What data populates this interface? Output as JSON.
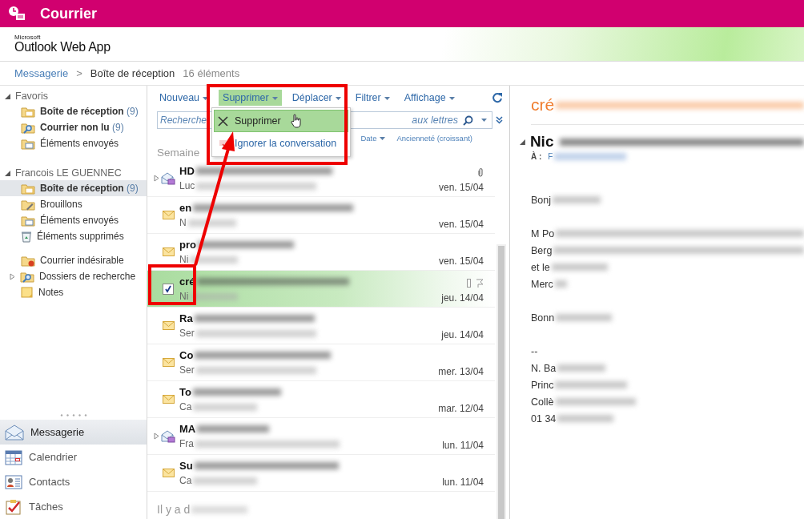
{
  "header": {
    "title": "Courrier"
  },
  "logo": {
    "maker": "Microsoft",
    "product": "Outlook Web App"
  },
  "breadcrumb": {
    "root": "Messagerie",
    "separator": ">",
    "current": "Boîte de réception",
    "count": "16 éléments"
  },
  "sidebar": {
    "groups": [
      {
        "title": "Favoris",
        "expanded": true,
        "sections": [
          {
            "items": [
              {
                "kind": "inbox",
                "label": "Boîte de réception",
                "count": "(9)",
                "unread": true,
                "selected": false,
                "expandable": false
              },
              {
                "kind": "search",
                "label": "Courrier non lu",
                "count": "(9)",
                "unread": true,
                "selected": false,
                "expandable": false
              },
              {
                "kind": "sent",
                "label": "Éléments envoyés",
                "unread": false,
                "selected": false,
                "expandable": false
              }
            ]
          }
        ]
      },
      {
        "title": "Francois LE GUENNEC",
        "expanded": true,
        "sections": [
          {
            "items": [
              {
                "kind": "inbox",
                "label": "Boîte de réception",
                "count": "(9)",
                "unread": true,
                "selected": true,
                "expandable": false
              },
              {
                "kind": "drafts",
                "label": "Brouillons",
                "unread": false,
                "selected": false,
                "expandable": false
              },
              {
                "kind": "sent",
                "label": "Éléments envoyés",
                "unread": false,
                "selected": false,
                "expandable": false
              },
              {
                "kind": "deleted",
                "label": "Éléments supprimés",
                "unread": false,
                "selected": false,
                "expandable": false
              }
            ]
          },
          {
            "items": [
              {
                "kind": "junk",
                "label": "Courrier indésirable",
                "unread": false,
                "selected": false,
                "expandable": false
              },
              {
                "kind": "search",
                "label": "Dossiers de recherche",
                "unread": false,
                "selected": false,
                "expandable": true
              },
              {
                "kind": "notes",
                "label": "Notes",
                "unread": false,
                "selected": false,
                "expandable": false
              }
            ]
          }
        ]
      }
    ],
    "nav": [
      {
        "kind": "mail",
        "label": "Messagerie",
        "selected": true
      },
      {
        "kind": "calendar",
        "label": "Calendrier",
        "selected": false
      },
      {
        "kind": "contacts",
        "label": "Contacts",
        "selected": false
      },
      {
        "kind": "tasks",
        "label": "Tâches",
        "selected": false
      }
    ]
  },
  "toolbar": {
    "buttons": [
      {
        "label": "Nouveau",
        "open": false
      },
      {
        "label": "Supprimer",
        "open": true
      },
      {
        "label": "Déplacer",
        "open": false
      },
      {
        "label": "Filtrer",
        "open": false
      },
      {
        "label": "Affichage",
        "open": false
      }
    ]
  },
  "search": {
    "placeholder": "Recherche",
    "hint_end": "aux lettres"
  },
  "menu": {
    "items": [
      {
        "kind": "delete",
        "label": "Supprimer",
        "selected": true
      },
      {
        "kind": "ignore",
        "label": "Ignorer la conversation",
        "selected": false
      }
    ]
  },
  "sort": {
    "field": "Date",
    "order": "Ancienneté (croissant)"
  },
  "list": {
    "group_heading": "Semaine",
    "messages": [
      {
        "kind": "conversation",
        "expandable": true,
        "selected": false,
        "subject": "HD",
        "sender": "Luc",
        "date": "ven. 15/04",
        "attachment": true
      },
      {
        "kind": "envelope",
        "expandable": false,
        "selected": false,
        "subject": "en",
        "sender": "N",
        "date": "ven. 15/04",
        "attachment": false
      },
      {
        "kind": "envelope",
        "expandable": false,
        "selected": false,
        "subject": "pro",
        "sender": "Ni",
        "date": "ven. 15/04",
        "attachment": false
      },
      {
        "kind": "checkbox",
        "expandable": false,
        "checked": true,
        "selected": true,
        "subject": "cré",
        "sender": "Ni",
        "date": "jeu. 14/04",
        "attachment": false
      },
      {
        "kind": "envelope",
        "expandable": false,
        "selected": false,
        "subject": "Ra",
        "sender": "Ser",
        "date": "jeu. 14/04",
        "attachment": false
      },
      {
        "kind": "envelope",
        "expandable": false,
        "selected": false,
        "subject": "Co",
        "sender": "Ser",
        "date": "mer. 13/04",
        "attachment": false
      },
      {
        "kind": "envelope",
        "expandable": false,
        "selected": false,
        "subject": "To",
        "sender": "Ca",
        "date": "mar. 12/04",
        "attachment": false
      },
      {
        "kind": "conversation",
        "expandable": true,
        "selected": false,
        "subject": "MA",
        "sender": "Fra",
        "date": "lun. 11/04",
        "attachment": false
      },
      {
        "kind": "envelope",
        "expandable": false,
        "selected": false,
        "subject": "Su",
        "sender": "Ca",
        "date": "lun. 11/04",
        "attachment": false
      }
    ],
    "next_heading": "Il y a d"
  },
  "reading": {
    "subject": "cré",
    "sender": "Nic",
    "to_label": "À :",
    "to": "F",
    "paragraphs": [
      {
        "lines": [
          {
            "text": "Bonj",
            "blurred": true
          }
        ]
      },
      {
        "lines": [
          {
            "text": "M Po",
            "blurred": true
          },
          {
            "text": "Berg",
            "blurred": true
          },
          {
            "text": "et le",
            "blurred": true
          },
          {
            "text": "Merc",
            "blurred": true
          }
        ]
      },
      {
        "lines": [
          {
            "text": "Bonn",
            "blurred": true
          }
        ]
      },
      {
        "lines": [
          {
            "text": "--",
            "blurred": false
          },
          {
            "text": "N. Ba",
            "blurred": true
          },
          {
            "text": "Princ",
            "blurred": true
          },
          {
            "text": "Collè",
            "blurred": true
          },
          {
            "text": "01 34",
            "blurred": true
          }
        ]
      }
    ]
  }
}
